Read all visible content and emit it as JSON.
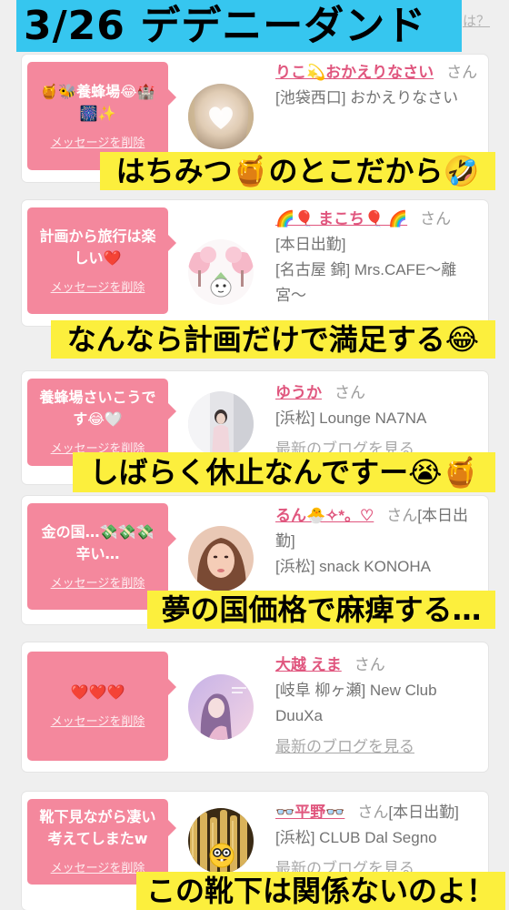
{
  "header": {
    "title": "3/26 デデニーダンド",
    "corner_link": "は？"
  },
  "messages": [
    {
      "bubble_text": "🍯🐝養蜂場😂🏰🎆✨",
      "delete_label": "メッセージを削除",
      "name": "りこ💫おかえりなさい",
      "honorific": "さん",
      "location": "[池袋西口] おかえりなさい",
      "avatar_overlay_icon": "heart-icon"
    },
    {
      "bubble_text": "計画から旅行は楽しい❤️",
      "delete_label": "メッセージを削除",
      "name": "🌈🎈 まこち🎈 🌈",
      "honorific": "さん",
      "status": "[本日出勤]",
      "location": "[名古屋 錦] Mrs.CAFE〜離宮〜"
    },
    {
      "bubble_text": "養蜂場さいこうです😂🤍",
      "delete_label": "メッセージを削除",
      "name": "ゆうか",
      "honorific": "さん",
      "location": "[浜松] Lounge NA7NA",
      "blog_link": "最新のブログを見る"
    },
    {
      "bubble_text": "金の国…💸💸💸辛い…",
      "delete_label": "メッセージを削除",
      "name": "るん🐣✧*。♡",
      "honorific": "さん",
      "status": "[本日出勤]",
      "location": "[浜松] snack KONOHA"
    },
    {
      "bubble_text": "❤️❤️❤️",
      "delete_label": "メッセージを削除",
      "name": "大越 えま",
      "honorific": "さん",
      "location": "[岐阜 柳ヶ瀬] New Club DuuXa",
      "blog_link": "最新のブログを見る"
    },
    {
      "bubble_text": "靴下見ながら凄い考えてしまたw",
      "delete_label": "メッセージを削除",
      "name": "👓平野👓",
      "honorific": "さん",
      "status": "[本日出勤]",
      "location": "[浜松] CLUB Dal Segno",
      "blog_link": "最新のブログを見る",
      "avatar_overlay_icon": "nerd-face-icon"
    }
  ],
  "captions": [
    "はちみつ🍯のとこだから🤣",
    "なんなら計画だけで満足する😂",
    "しばらく休止なんですー😭🍯",
    "夢の国価格で麻痺する…",
    "この靴下は関係ないのよ！"
  ],
  "colors": {
    "page_bg": "#efefef",
    "card_bg": "#ffffff",
    "bubble": "#f4889d",
    "name_link": "#e0567e",
    "caption_bg": "#fcef3d",
    "title_bg": "#36c6ef",
    "muted_text": "#737373"
  }
}
